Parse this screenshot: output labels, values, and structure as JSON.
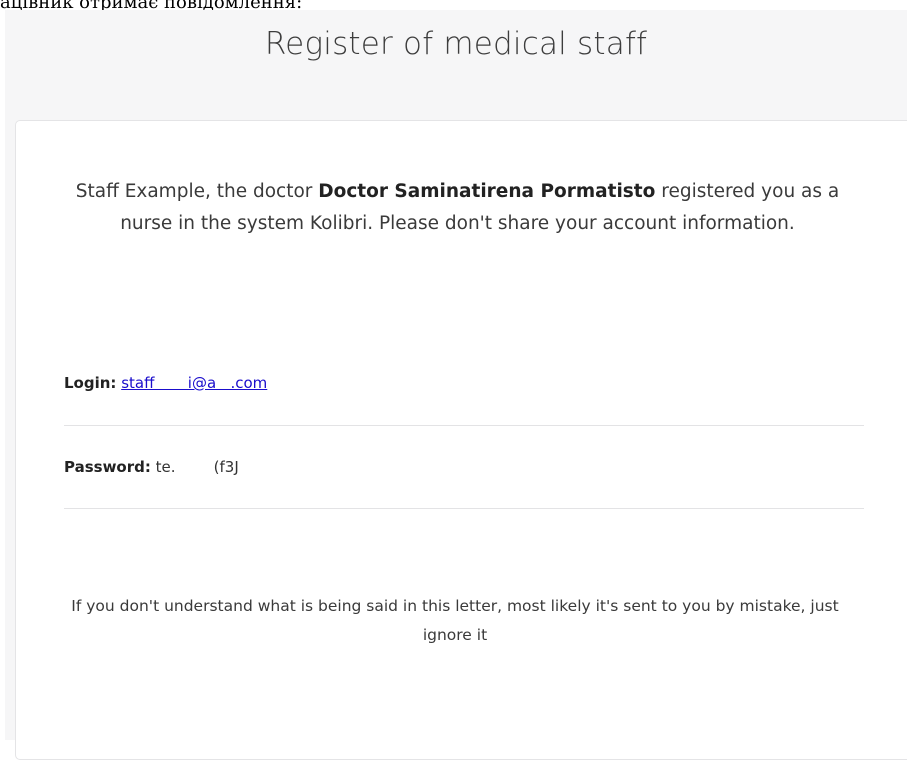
{
  "top_fragment": "ацівник отримає повідомлення:",
  "email": {
    "title": "Register of medical staff",
    "intro": {
      "prefix": "Staff Example, the doctor ",
      "doctor_name": "Doctor Saminatirena Pormatisto",
      "suffix": " registered you as a nurse in the system Kolibri. Please don't share your account information."
    },
    "login": {
      "label": "Login:",
      "value": "staff       i@a   .com"
    },
    "password": {
      "label": "Password:",
      "value": "te.        (f3J"
    },
    "footer_note": "If you don't understand what is being said in this letter, most likely it's sent to you by mistake, just ignore it"
  }
}
